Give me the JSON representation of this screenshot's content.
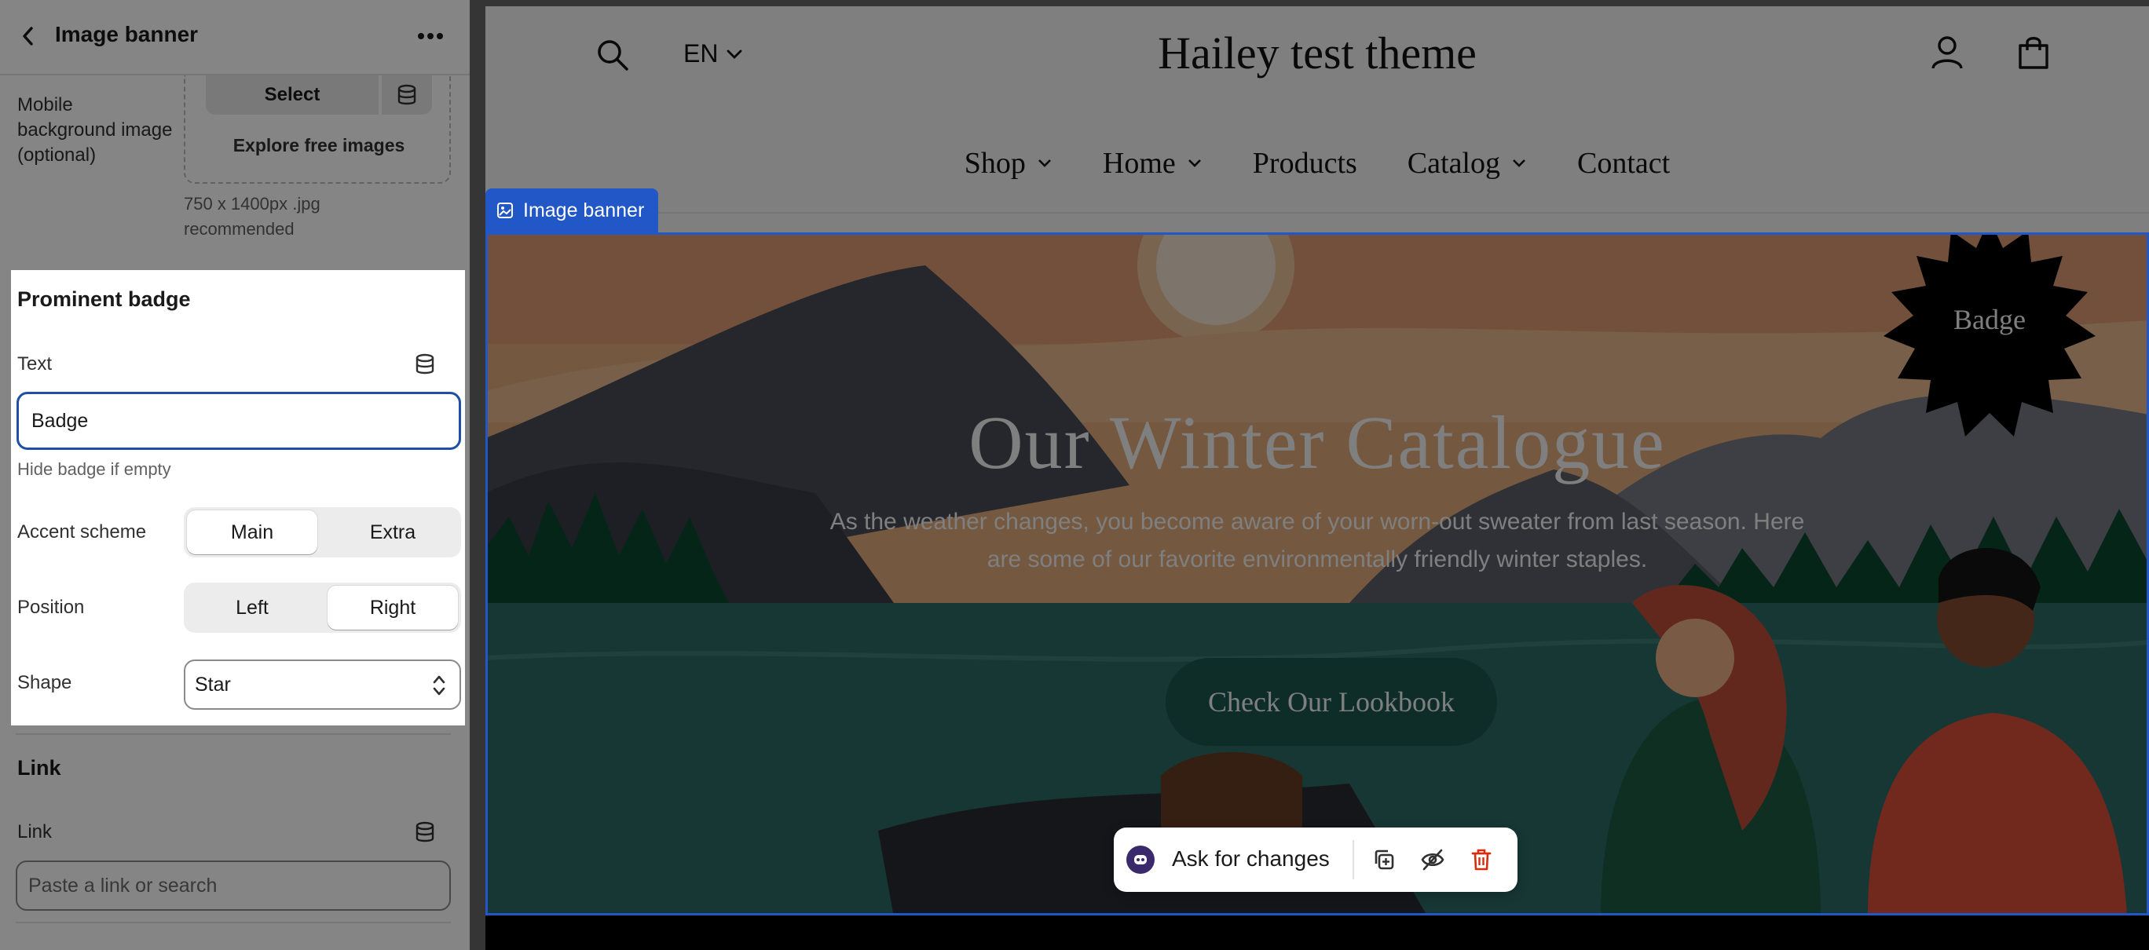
{
  "editor": {
    "title": "Image banner",
    "mobile_bg": {
      "label": "Mobile background image (optional)",
      "select_label": "Select",
      "explore_label": "Explore free images",
      "hint": "750 x 1400px .jpg recommended"
    },
    "badge": {
      "section_title": "Prominent badge",
      "text_label": "Text",
      "text_value": "Badge",
      "hide_hint": "Hide badge if empty",
      "accent_label": "Accent scheme",
      "accent_options": [
        "Main",
        "Extra"
      ],
      "accent_selected": "Main",
      "position_label": "Position",
      "position_options": [
        "Left",
        "Right"
      ],
      "position_selected": "Right",
      "shape_label": "Shape",
      "shape_value": "Star"
    },
    "link": {
      "section_title": "Link",
      "link_label": "Link",
      "placeholder": "Paste a link or search"
    }
  },
  "preview": {
    "store_name": "Hailey test theme",
    "language": "EN",
    "nav": [
      "Shop",
      "Home",
      "Products",
      "Catalog",
      "Contact"
    ],
    "nav_dropdowns": [
      "Shop",
      "Home",
      "Catalog"
    ],
    "section_tag": "Image banner",
    "banner": {
      "heading": "Our Winter Catalogue",
      "subheading": "As the weather changes, you become aware of your worn-out sweater from last season. Here are some of our favorite environmentally friendly winter staples.",
      "button": "Check Our Lookbook",
      "badge_text": "Badge"
    }
  },
  "toolbar": {
    "ask_label": "Ask for changes",
    "icons": [
      "duplicate-icon",
      "hide-icon",
      "delete-icon"
    ]
  },
  "colors": {
    "selection_blue": "#2157c6",
    "cta_green": "#1c5a52",
    "badge_black": "#000000",
    "delete_red": "#d72c0d"
  }
}
